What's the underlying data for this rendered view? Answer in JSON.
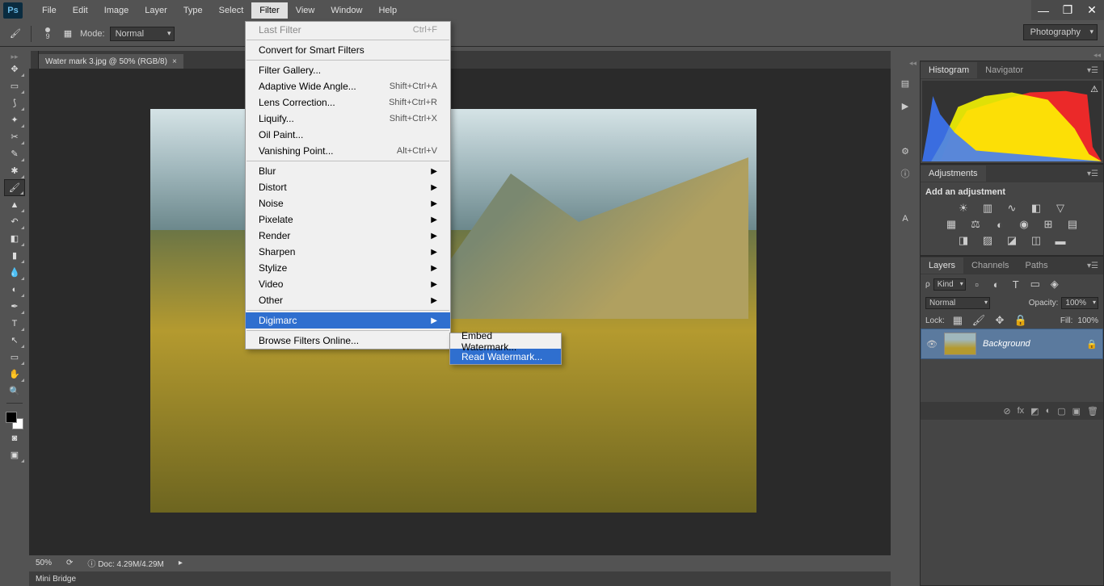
{
  "app": {
    "logo": "Ps"
  },
  "menus": [
    "File",
    "Edit",
    "Image",
    "Layer",
    "Type",
    "Select",
    "Filter",
    "View",
    "Window",
    "Help"
  ],
  "open_menu_index": 6,
  "workspace": "Photography",
  "option_bar": {
    "mode_label": "Mode:",
    "mode_value": "Normal",
    "brush_size": "9"
  },
  "document": {
    "tab_title": "Water mark 3.jpg @ 50% (RGB/8)"
  },
  "status": {
    "zoom": "50%",
    "doc_info": "Doc: 4.29M/4.29M"
  },
  "bottom_tab": "Mini Bridge",
  "dropdown": {
    "last_filter": {
      "label": "Last Filter",
      "shortcut": "Ctrl+F",
      "disabled": true
    },
    "convert": "Convert for Smart Filters",
    "gallery": "Filter Gallery...",
    "adaptive": {
      "label": "Adaptive Wide Angle...",
      "shortcut": "Shift+Ctrl+A"
    },
    "lens": {
      "label": "Lens Correction...",
      "shortcut": "Shift+Ctrl+R"
    },
    "liquify": {
      "label": "Liquify...",
      "shortcut": "Shift+Ctrl+X"
    },
    "oil": "Oil Paint...",
    "vanish": {
      "label": "Vanishing Point...",
      "shortcut": "Alt+Ctrl+V"
    },
    "sub_groups": [
      "Blur",
      "Distort",
      "Noise",
      "Pixelate",
      "Render",
      "Sharpen",
      "Stylize",
      "Video",
      "Other"
    ],
    "digimarc": "Digimarc",
    "browse": "Browse Filters Online..."
  },
  "submenu": {
    "embed": "Embed Watermark...",
    "read": "Read Watermark..."
  },
  "panels": {
    "histogram_tabs": [
      "Histogram",
      "Navigator"
    ],
    "adjustments_tab": "Adjustments",
    "adjustments_label": "Add an adjustment",
    "layers_tabs": [
      "Layers",
      "Channels",
      "Paths"
    ],
    "layers": {
      "kind": "Kind",
      "blend_mode": "Normal",
      "opacity_label": "Opacity:",
      "opacity_value": "100%",
      "lock_label": "Lock:",
      "fill_label": "Fill:",
      "fill_value": "100%",
      "layer_name": "Background"
    }
  }
}
